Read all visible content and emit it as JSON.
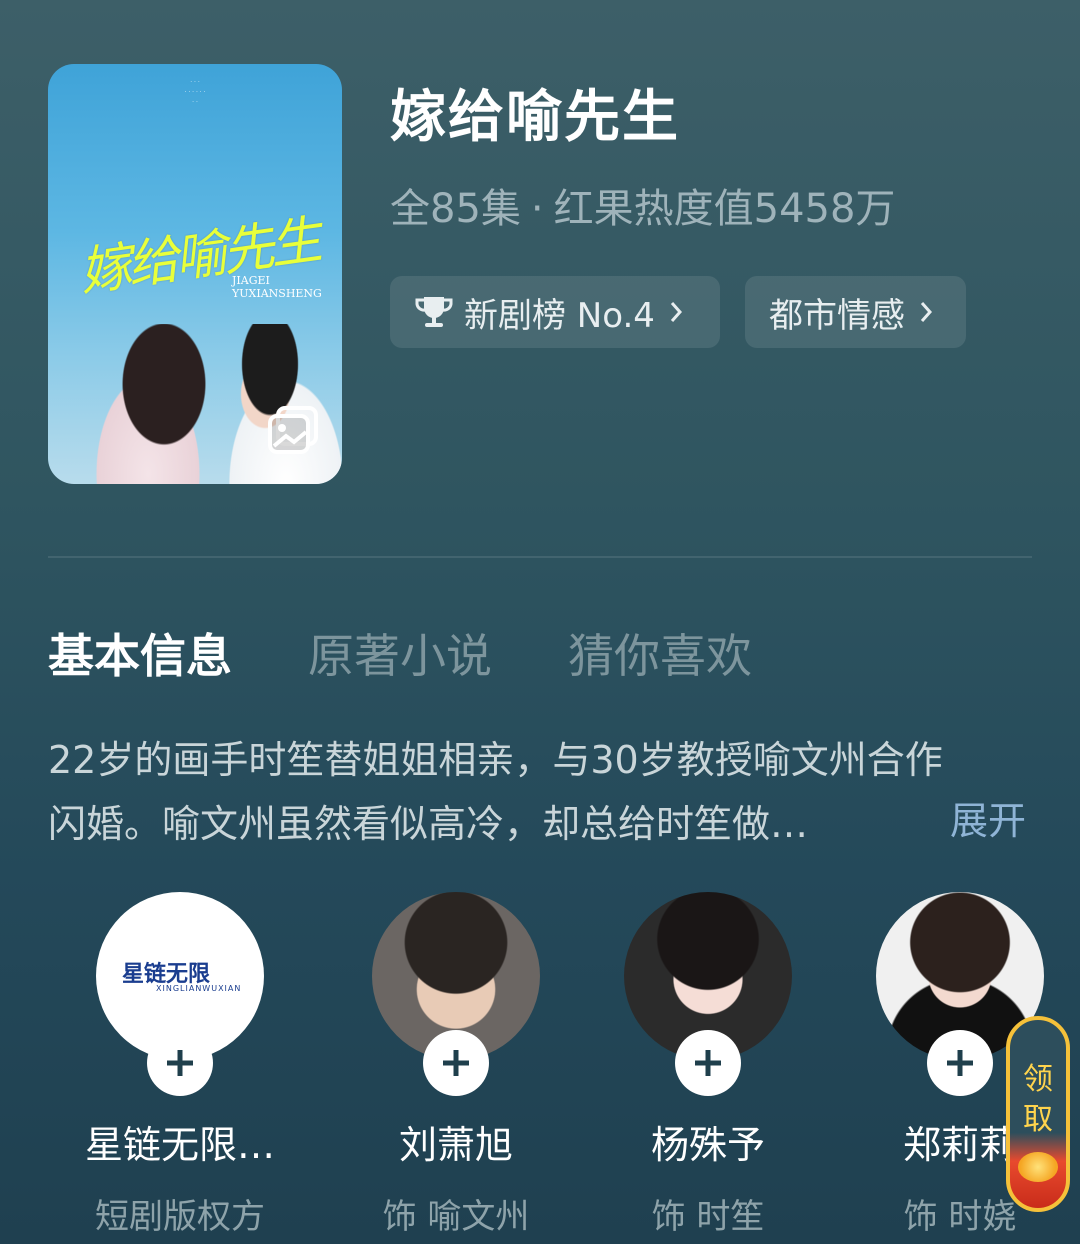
{
  "drama": {
    "title": "嫁给喻先生",
    "episodes": "全85集",
    "separator": "·",
    "popularity": "红果热度值5458万",
    "tags": [
      {
        "label": "新剧榜 No.4",
        "icon": "trophy-icon"
      },
      {
        "label": "都市情感"
      }
    ]
  },
  "poster": {
    "calligraphy": "嫁给喻先生",
    "pinyin_1": "JIAGEI",
    "pinyin_2": "YUXIANSHENG"
  },
  "tabs": [
    "基本信息",
    "原著小说",
    "猜你喜欢"
  ],
  "synopsis": {
    "line1": "22岁的画手时笙替姐姐相亲，与30岁教授喻文州合作",
    "line2": "闪婚。喻文州虽然看似高冷，却总给时笙做…",
    "expand_label": "展开"
  },
  "cast": [
    {
      "name": "星链无限…",
      "role": "短剧版权方",
      "logo_text": "星链无限",
      "logo_sub": "XINGLIANWUXIAN"
    },
    {
      "name": "刘萧旭",
      "role": "饰 喻文州"
    },
    {
      "name": "杨殊予",
      "role": "饰 时笙"
    },
    {
      "name": "郑莉莉",
      "role": "饰 时娆"
    }
  ],
  "reward": {
    "label_line1": "领",
    "label_line2": "取"
  },
  "colors": {
    "accent_link": "#8fb4d6",
    "reward_gold": "#f5c13a",
    "reward_red": "#e84a2e"
  }
}
